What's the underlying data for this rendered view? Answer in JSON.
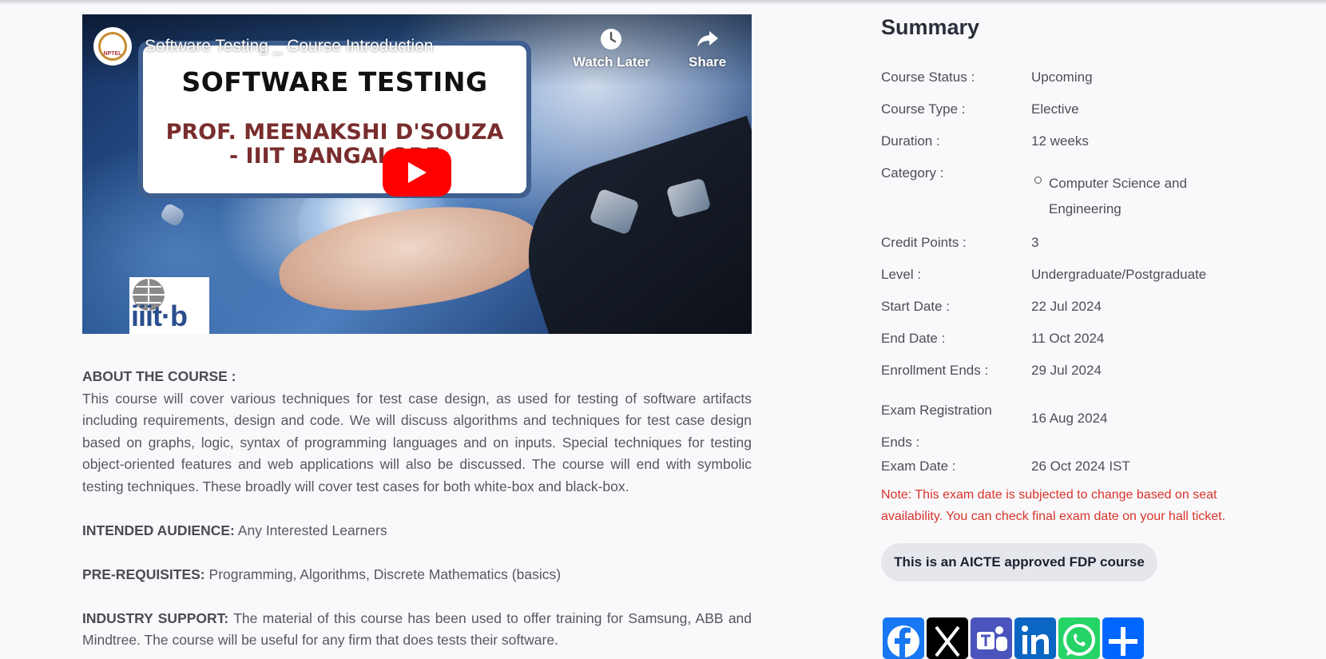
{
  "video": {
    "title": "Software Testing _ Course Introduction",
    "watch_later": "Watch Later",
    "share": "Share",
    "card_line1": "SOFTWARE TESTING",
    "card_line2": "PROF. MEENAKSHI D'SOUZA",
    "card_line3": "- IIIT BANGALORE",
    "channel_badge": "NPTEL",
    "logo_text": "iiit·b"
  },
  "about": {
    "heading": "ABOUT THE COURSE :",
    "body": "This course will cover various techniques for test case design, as used for testing of software artifacts including requirements, design and code. We will discuss algorithms and techniques for test case design based on graphs, logic, syntax of programming languages and on inputs. Special techniques for testing object-oriented features and web applications will also be discussed. The course will end with symbolic testing techniques. These broadly will cover test cases for both white-box and black-box.",
    "audience_label": "INTENDED AUDIENCE:",
    "audience_value": "Any Interested Learners",
    "prereq_label": "PRE-REQUISITES:",
    "prereq_value": "Programming, Algorithms, Discrete Mathematics (basics)",
    "industry_label": "INDUSTRY SUPPORT:",
    "industry_value": "The material of this course has been used to offer training for Samsung, ABB and Mindtree. The course will be useful for any firm that does tests their software."
  },
  "summary": {
    "title": "Summary",
    "rows": [
      {
        "label": "Course Status :",
        "value": "Upcoming"
      },
      {
        "label": "Course Type :",
        "value": "Elective"
      },
      {
        "label": "Duration :",
        "value": "12 weeks"
      },
      {
        "label": "Category :",
        "value": "Computer Science and Engineering"
      },
      {
        "label": "Credit Points :",
        "value": "3"
      },
      {
        "label": "Level :",
        "value": "Undergraduate/Postgraduate"
      },
      {
        "label": "Start Date :",
        "value": "22 Jul 2024"
      },
      {
        "label": "End Date :",
        "value": "11 Oct 2024"
      },
      {
        "label": "Enrollment Ends :",
        "value": "29 Jul 2024"
      },
      {
        "label": "Exam Registration Ends :",
        "value": "16 Aug 2024"
      },
      {
        "label": "Exam Date :",
        "value": "26 Oct 2024 IST"
      }
    ],
    "note": "Note: This exam date is subjected to change based on seat availability. You can check final exam date on your hall ticket.",
    "aicte": "This is an AICTE approved FDP course"
  },
  "share_buttons": [
    {
      "name": "facebook-icon",
      "color": "#1877f2"
    },
    {
      "name": "x-icon",
      "color": "#000000"
    },
    {
      "name": "teams-icon",
      "color": "#4b53bc"
    },
    {
      "name": "linkedin-icon",
      "color": "#0a66c2"
    },
    {
      "name": "whatsapp-icon",
      "color": "#25d366"
    },
    {
      "name": "share-plus-icon",
      "color": "#0166ff"
    }
  ]
}
